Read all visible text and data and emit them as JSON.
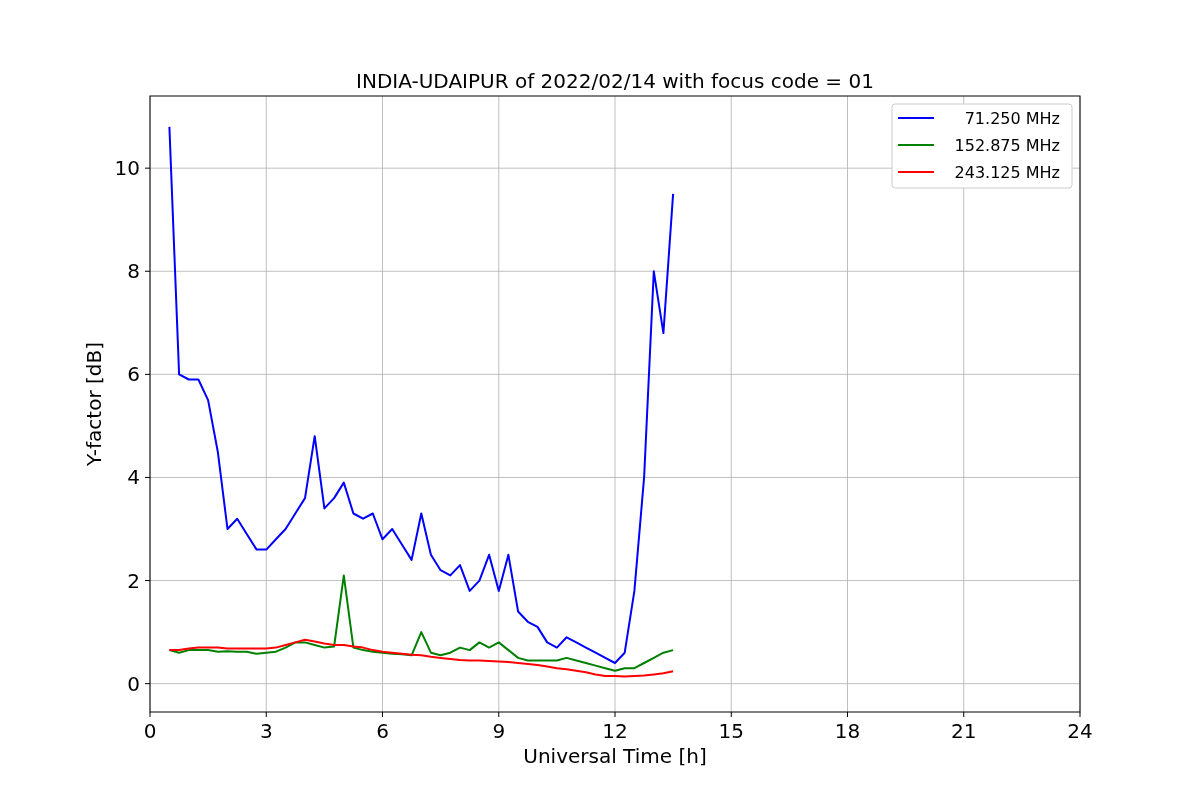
{
  "chart_data": {
    "type": "line",
    "title": "INDIA-UDAIPUR of 2022/02/14 with focus code = 01",
    "xlabel": "Universal Time [h]",
    "ylabel": "Y-factor [dB]",
    "x": [
      0.5,
      0.75,
      1.0,
      1.25,
      1.5,
      1.75,
      2.0,
      2.25,
      2.5,
      2.75,
      3.0,
      3.25,
      3.5,
      3.75,
      4.0,
      4.25,
      4.5,
      4.75,
      5.0,
      5.25,
      5.5,
      5.75,
      6.0,
      6.25,
      6.5,
      6.75,
      7.0,
      7.25,
      7.5,
      7.75,
      8.0,
      8.25,
      8.5,
      8.75,
      9.0,
      9.25,
      9.5,
      9.75,
      10.0,
      10.25,
      10.5,
      10.75,
      11.0,
      11.25,
      11.5,
      11.75,
      12.0,
      12.25,
      12.5,
      12.75,
      13.0,
      13.25,
      13.5
    ],
    "series": [
      {
        "name": "71.250 MHz",
        "color": "#0000ff",
        "values": [
          10.8,
          6.0,
          5.9,
          5.9,
          5.5,
          4.5,
          3.0,
          3.2,
          2.9,
          2.6,
          2.6,
          2.8,
          3.0,
          3.3,
          3.6,
          4.8,
          3.4,
          3.6,
          3.9,
          3.3,
          3.2,
          3.3,
          2.8,
          3.0,
          2.7,
          2.4,
          3.3,
          2.5,
          2.2,
          2.1,
          2.3,
          1.8,
          2.0,
          2.5,
          1.8,
          2.5,
          1.4,
          1.2,
          1.1,
          0.8,
          0.7,
          0.9,
          0.8,
          0.7,
          0.6,
          0.5,
          0.4,
          0.6,
          1.8,
          4.0,
          8.0,
          6.8,
          9.5
        ]
      },
      {
        "name": "152.875 MHz",
        "color": "#008000",
        "values": [
          0.65,
          0.6,
          0.65,
          0.65,
          0.65,
          0.62,
          0.63,
          0.62,
          0.62,
          0.58,
          0.6,
          0.62,
          0.7,
          0.8,
          0.8,
          0.75,
          0.7,
          0.72,
          2.1,
          0.7,
          0.65,
          0.62,
          0.6,
          0.58,
          0.57,
          0.55,
          1.0,
          0.6,
          0.55,
          0.6,
          0.7,
          0.65,
          0.8,
          0.7,
          0.8,
          0.65,
          0.5,
          0.45,
          0.45,
          0.45,
          0.45,
          0.5,
          0.45,
          0.4,
          0.35,
          0.3,
          0.25,
          0.3,
          0.3,
          0.4,
          0.5,
          0.6,
          0.65
        ]
      },
      {
        "name": "243.125 MHz",
        "color": "#ff0000",
        "values": [
          0.65,
          0.65,
          0.68,
          0.7,
          0.7,
          0.7,
          0.68,
          0.68,
          0.68,
          0.68,
          0.68,
          0.7,
          0.75,
          0.8,
          0.85,
          0.82,
          0.78,
          0.75,
          0.75,
          0.72,
          0.7,
          0.65,
          0.62,
          0.6,
          0.58,
          0.56,
          0.55,
          0.52,
          0.5,
          0.48,
          0.46,
          0.45,
          0.45,
          0.44,
          0.43,
          0.42,
          0.4,
          0.38,
          0.36,
          0.33,
          0.3,
          0.28,
          0.25,
          0.22,
          0.18,
          0.15,
          0.15,
          0.14,
          0.15,
          0.16,
          0.18,
          0.2,
          0.24
        ]
      }
    ],
    "xlim": [
      0,
      24
    ],
    "ylim": [
      -0.55,
      11.4
    ],
    "xticks": [
      0,
      3,
      6,
      9,
      12,
      15,
      18,
      21,
      24
    ],
    "yticks": [
      0,
      2,
      4,
      6,
      8,
      10
    ],
    "grid": true,
    "legend": "upper right"
  }
}
